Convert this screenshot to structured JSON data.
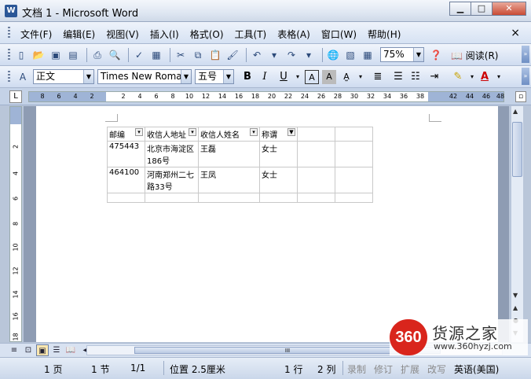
{
  "window": {
    "title": "文档 1 - Microsoft Word",
    "app_icon": "W",
    "minimize": "▁",
    "maximize": "□",
    "close": "✕"
  },
  "menu": {
    "items": [
      "文件(F)",
      "编辑(E)",
      "视图(V)",
      "插入(I)",
      "格式(O)",
      "工具(T)",
      "表格(A)",
      "窗口(W)",
      "帮助(H)"
    ],
    "close": "×"
  },
  "standard_toolbar": {
    "zoom": "75%",
    "reading": "阅读(R)"
  },
  "formatting_toolbar": {
    "style": "正文",
    "font": "Times New Roman",
    "size": "五号",
    "bold": "B",
    "italic": "I",
    "underline": "U"
  },
  "ruler": {
    "numbers": [
      "8",
      "6",
      "4",
      "2",
      "2",
      "4",
      "6",
      "8",
      "10",
      "12",
      "14",
      "16",
      "18",
      "20",
      "22",
      "24",
      "26",
      "28",
      "30",
      "32",
      "34",
      "36",
      "38",
      "42",
      "44",
      "46",
      "48"
    ]
  },
  "vruler": {
    "numbers": [
      "2",
      "4",
      "6",
      "8",
      "10",
      "12",
      "14",
      "16",
      "18"
    ]
  },
  "table": {
    "headers": [
      "邮编",
      "收信人地址",
      "收信人姓名",
      "称谓",
      "",
      ""
    ],
    "rows": [
      [
        "475443",
        "北京市海淀区186号",
        "王磊",
        "女士",
        "",
        ""
      ],
      [
        "464100",
        "河南郑州二七路33号",
        "王凤",
        "女士",
        "",
        ""
      ],
      [
        "",
        "",
        "",
        "",
        "",
        ""
      ]
    ]
  },
  "status": {
    "page": "1 页",
    "section": "1 节",
    "pages": "1/1",
    "position": "位置 2.5厘米",
    "line": "1 行",
    "column": "2 列",
    "rec": "录制",
    "trk": "修订",
    "ext": "扩展",
    "ovr": "改写",
    "lang": "英语(美国)"
  },
  "watermark": {
    "badge": "360",
    "name": "货源之家",
    "url": "www.360hyzj.com"
  },
  "scroll": {
    "hthumb_label": "III"
  }
}
